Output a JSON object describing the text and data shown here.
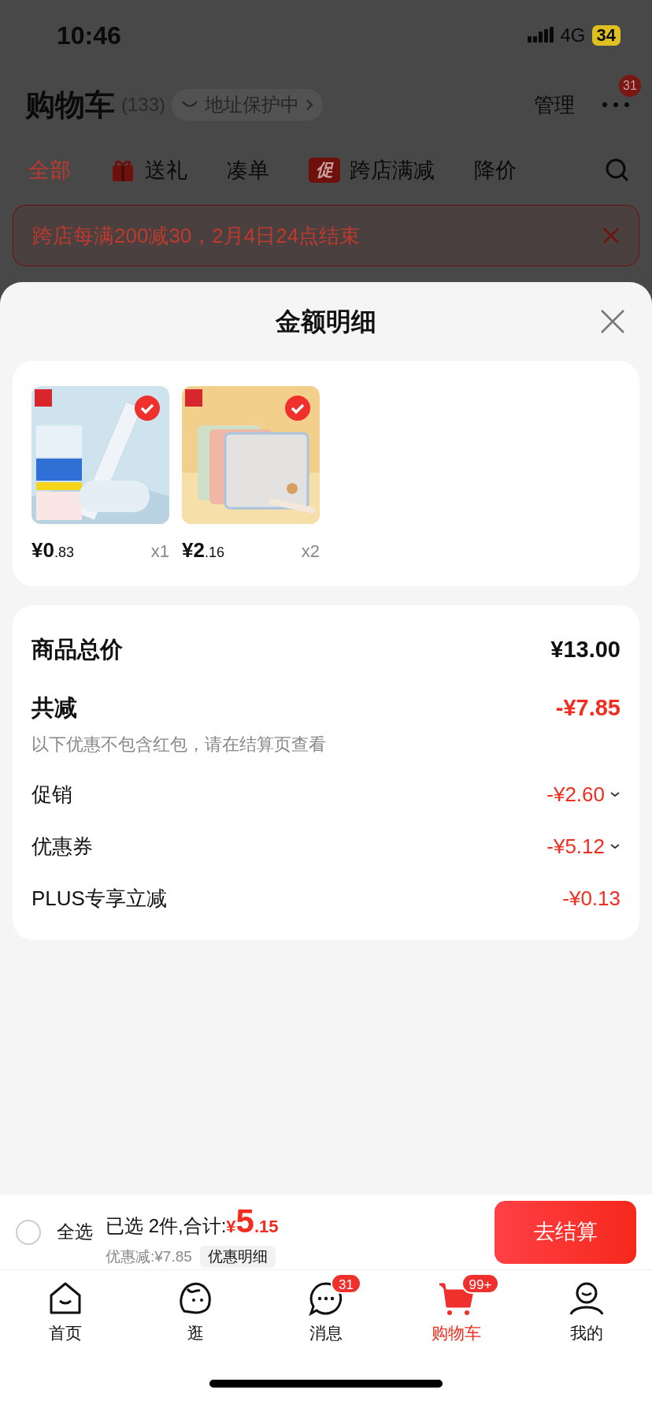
{
  "status_bar": {
    "time": "10:46",
    "network": "4G",
    "battery": "34"
  },
  "header": {
    "title": "购物车",
    "count": "(133)",
    "address_badge": "地址保护中",
    "manage": "管理",
    "more_badge": "31"
  },
  "tabs": [
    {
      "label": "全部",
      "selected": true,
      "kind": "plain"
    },
    {
      "label": "送礼",
      "selected": false,
      "kind": "gift"
    },
    {
      "label": "凑单",
      "selected": false,
      "kind": "plain"
    },
    {
      "label": "跨店满减",
      "selected": false,
      "kind": "promo",
      "tag": "促"
    },
    {
      "label": "降价",
      "selected": false,
      "kind": "plain"
    }
  ],
  "promo_banner": {
    "text": "跨店每满200减30，2月4日24点结束"
  },
  "sheet": {
    "title": "金额明细",
    "items": [
      {
        "price_int": "¥0",
        "price_dec": ".83",
        "quantity": "x1",
        "checked": true,
        "kind": "ruler"
      },
      {
        "price_int": "¥2",
        "price_dec": ".16",
        "quantity": "x2",
        "checked": true,
        "kind": "pouch"
      }
    ],
    "summary": [
      {
        "kind": "total",
        "label": "商品总价",
        "value": "¥13.00"
      },
      {
        "kind": "discount",
        "label": "共减",
        "value": "-¥7.85"
      },
      {
        "kind": "note",
        "label": "以下优惠不包含红包，请在结算页查看"
      },
      {
        "kind": "detail",
        "label": "促销",
        "value": "-¥2.60",
        "expandable": true
      },
      {
        "kind": "detail",
        "label": "优惠券",
        "value": "-¥5.12",
        "expandable": true
      },
      {
        "kind": "detail",
        "label": "PLUS专享立减",
        "value": "-¥0.13",
        "expandable": false
      }
    ]
  },
  "checkout_bar": {
    "select_all": {
      "label": "全选",
      "checked": false
    },
    "selected_text": "已选 2件,合计:",
    "currency": "¥",
    "total_int": "5",
    "total_dec": ".15",
    "saving": "优惠减:¥7.85",
    "detail_button": "优惠明细",
    "checkout_button": "去结算"
  },
  "nav": [
    {
      "label": "首页",
      "kind": "home",
      "selected": false
    },
    {
      "label": "逛",
      "kind": "stroll",
      "selected": false
    },
    {
      "label": "消息",
      "kind": "message",
      "selected": false,
      "badge": "31"
    },
    {
      "label": "购物车",
      "kind": "cart",
      "selected": true,
      "badge": "99+"
    },
    {
      "label": "我的",
      "kind": "profile",
      "selected": false
    }
  ]
}
